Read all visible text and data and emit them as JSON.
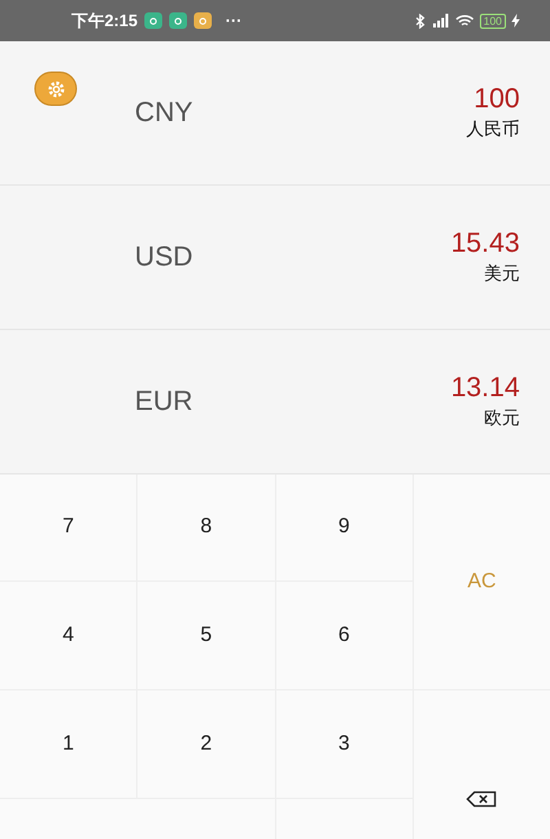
{
  "status_bar": {
    "time": "下午2:15",
    "notification_icons": [
      {
        "color": "#3bb58a"
      },
      {
        "color": "#3bb58a"
      },
      {
        "color": "#e8b04a"
      }
    ],
    "more": "···",
    "battery": "100"
  },
  "currencies": [
    {
      "code": "CNY",
      "amount": "100",
      "name": "人民币"
    },
    {
      "code": "USD",
      "amount": "15.43",
      "name": "美元"
    },
    {
      "code": "EUR",
      "amount": "13.14",
      "name": "欧元"
    }
  ],
  "keypad": {
    "digit_rows": [
      [
        "7",
        "8",
        "9"
      ],
      [
        "4",
        "5",
        "6"
      ],
      [
        "1",
        "2",
        "3"
      ]
    ],
    "clear": "AC"
  }
}
